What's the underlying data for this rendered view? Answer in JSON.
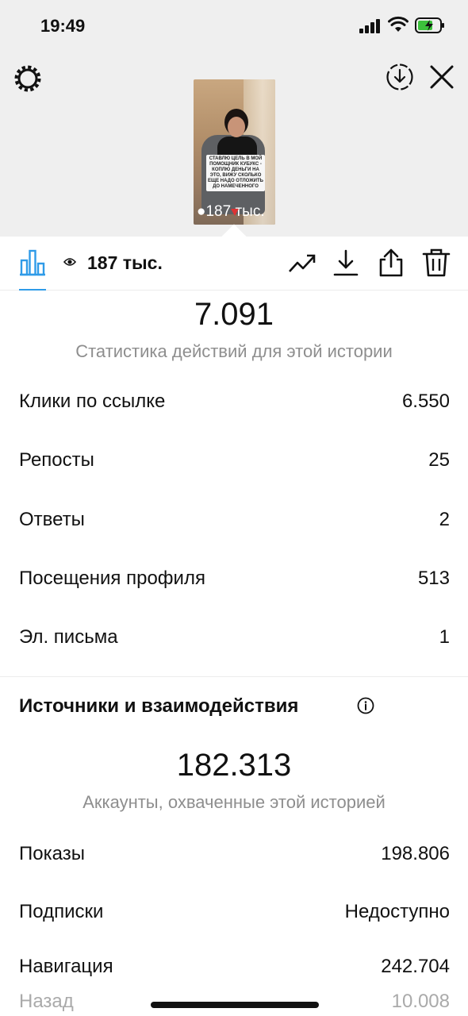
{
  "status_bar": {
    "time": "19:49"
  },
  "header": {
    "icons": [
      "gear-icon",
      "download-circle-icon",
      "close-icon"
    ],
    "story_preview": {
      "caption": "СТАВЛЮ ЦЕЛЬ В МОЙ ПОМОЩНИК КУБУКС - КОПЛЮ ДЕНЬГИ НА ЭТО, ВИЖУ СКОЛЬКО ЕЩЕ НАДО ОТЛОЖИТЬ ДО НАМЕЧЕННОГО",
      "views": "187 тыс."
    }
  },
  "toolbar": {
    "views_label": "187 тыс.",
    "icons": [
      "bar-chart-icon",
      "eye-icon",
      "trending-up-icon",
      "download-icon",
      "share-icon",
      "trash-icon"
    ],
    "accent_color": "#2f9be8"
  },
  "actions": {
    "total": "7.091",
    "caption": "Статистика действий для этой истории",
    "rows": [
      {
        "label": "Клики по ссылке",
        "value": "6.550"
      },
      {
        "label": "Репосты",
        "value": "25"
      },
      {
        "label": "Ответы",
        "value": "2"
      },
      {
        "label": "Посещения профиля",
        "value": "513"
      },
      {
        "label": "Эл. письма",
        "value": "1"
      }
    ]
  },
  "discovery": {
    "title": "Источники и взаимодействия",
    "total": "182.313",
    "caption": "Аккаунты, охваченные этой историей",
    "rows": [
      {
        "label": "Показы",
        "value": "198.806"
      },
      {
        "label": "Подписки",
        "value": "Недоступно"
      },
      {
        "label": "Навигация",
        "value": "242.704"
      },
      {
        "label": "Назад",
        "value": "10.008"
      }
    ]
  }
}
